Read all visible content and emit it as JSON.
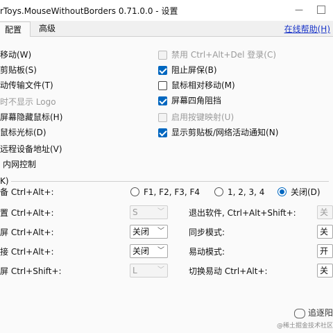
{
  "window": {
    "title": "rToys.MouseWithoutBorders 0.71.0.0 - 设置",
    "minimize": "—",
    "close": "✕"
  },
  "tabs": [
    {
      "label": "配置"
    },
    {
      "label": "高级"
    }
  ],
  "help_link": "在线帮助(H)",
  "left_options": [
    "移动(W)",
    "剪贴板(S)",
    "动传输文件(T)",
    "时不显示 Logo",
    "屏幕隐藏鼠标(H)",
    "鼠标光标(D)",
    "远程设备地址(V)",
    "内网控制"
  ],
  "right_options": [
    {
      "label": "禁用 Ctrl+Alt+Del 登录(C)",
      "checked": false,
      "disabled": true
    },
    {
      "label": "阻止屏保(B)",
      "checked": true,
      "disabled": false
    },
    {
      "label": "鼠标相对移动(M)",
      "checked": false,
      "disabled": false
    },
    {
      "label": "屏幕四角阻挡",
      "checked": true,
      "disabled": false
    },
    {
      "label": "启用按键映射(U)",
      "checked": false,
      "disabled": true
    },
    {
      "label": "显示剪贴板/网络活动通知(N)",
      "checked": true,
      "disabled": false
    }
  ],
  "hotkeys": {
    "group_label": "K)",
    "switch_label": "备 Ctrl+Alt+:",
    "radios": [
      {
        "label": "F1, F2, F3, F4",
        "selected": false
      },
      {
        "label": "1, 2, 3, 4",
        "selected": false
      },
      {
        "label": "关闭(D)",
        "selected": true
      }
    ],
    "left_rows": [
      {
        "label": "置 Ctrl+Alt+:",
        "value": "S",
        "disabled": true
      },
      {
        "label": "屏 Ctrl+Alt+:",
        "value": "关闭",
        "disabled": false
      },
      {
        "label": "接 Ctrl+Alt+:",
        "value": "关闭",
        "disabled": false
      },
      {
        "label": "屏 Ctrl+Shift+:",
        "value": "L",
        "disabled": true
      }
    ],
    "right_rows": [
      {
        "label": "退出软件, Ctrl+Alt+Shift+:",
        "value": "关闭",
        "disabled": true
      },
      {
        "label": "同步模式:",
        "value": "关闭",
        "disabled": false
      },
      {
        "label": "易动模式:",
        "value": "开启",
        "disabled": false
      },
      {
        "label": "切换易动 Ctrl+Alt+:",
        "value": "关闭",
        "disabled": false
      }
    ]
  },
  "watermark": {
    "main": "追逐阳",
    "sub": "@稀土掘金技术社区"
  },
  "colors": {
    "accent": "#0067c0",
    "link": "#1a35c8"
  }
}
